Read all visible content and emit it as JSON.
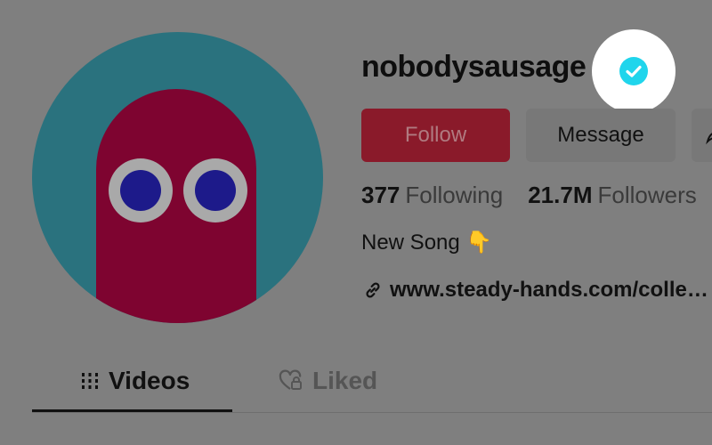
{
  "profile": {
    "username": "nobodysausage",
    "verified": true,
    "accent_color": "#20d5ec"
  },
  "actions": {
    "follow_label": "Follow",
    "message_label": "Message"
  },
  "stats": {
    "following_count": "377",
    "following_label": "Following",
    "followers_count": "21.7M",
    "followers_label": "Followers"
  },
  "bio": {
    "text": "New Song 👇",
    "link": "www.steady-hands.com/colle…"
  },
  "tabs": [
    {
      "label": "Videos",
      "icon": "grid-icon",
      "active": true
    },
    {
      "label": "Liked",
      "icon": "heart-lock-icon",
      "active": false
    }
  ]
}
